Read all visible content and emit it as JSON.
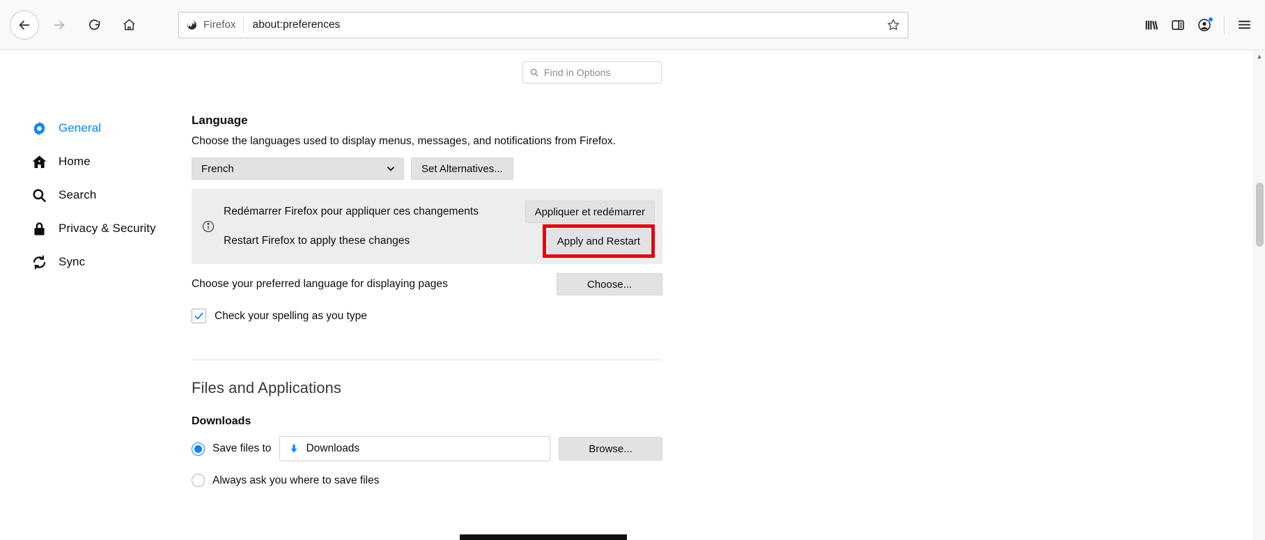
{
  "chrome": {
    "back_tooltip": "Back",
    "forward_tooltip": "Forward",
    "reload_tooltip": "Reload",
    "home_tooltip": "Home",
    "identity_label": "Firefox",
    "url": "about:preferences",
    "bookmark_tooltip": "Bookmark this page",
    "library_tooltip": "Library",
    "sidebar_tooltip": "Sidebars",
    "account_tooltip": "Account",
    "menu_tooltip": "Open Application Menu"
  },
  "search": {
    "placeholder": "Find in Options"
  },
  "sidebar": {
    "items": [
      {
        "label": "General",
        "icon": "gear-icon",
        "active": true
      },
      {
        "label": "Home",
        "icon": "home-icon",
        "active": false
      },
      {
        "label": "Search",
        "icon": "search-icon",
        "active": false
      },
      {
        "label": "Privacy & Security",
        "icon": "lock-icon",
        "active": false
      },
      {
        "label": "Sync",
        "icon": "sync-icon",
        "active": false
      }
    ]
  },
  "language": {
    "heading": "Language",
    "description": "Choose the languages used to display menus, messages, and notifications from Firefox.",
    "selected_language": "French",
    "set_alternatives_label": "Set Alternatives...",
    "notice": {
      "line_fr": "Redémarrer Firefox pour appliquer ces changements",
      "line_en": "Restart Firefox to apply these changes",
      "button_fr": "Appliquer et redémarrer",
      "button_en": "Apply and Restart",
      "highlight_color": "#e8000d"
    },
    "preferred_pages_label": "Choose your preferred language for displaying pages",
    "choose_button_label": "Choose...",
    "spellcheck_label": "Check your spelling as you type",
    "spellcheck_checked": true
  },
  "files": {
    "heading": "Files and Applications",
    "downloads_heading": "Downloads",
    "save_files_label": "Save files to",
    "download_path": "Downloads",
    "browse_label": "Browse...",
    "always_ask_label": "Always ask you where to save files",
    "save_files_selected": true,
    "always_ask_selected": false
  },
  "colors": {
    "accent": "#0a84ff",
    "highlight": "#e8000d",
    "notice_bg": "#ededf0",
    "button_bg": "#e2e2e4"
  }
}
